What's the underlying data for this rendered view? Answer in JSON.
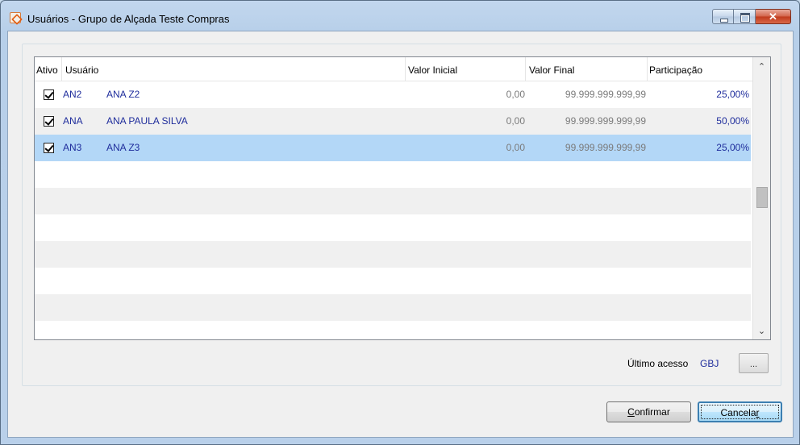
{
  "window": {
    "title": "Usuários - Grupo de Alçada Teste Compras",
    "close_glyph": "✕"
  },
  "grid": {
    "columns": [
      "Ativo",
      "Usuário",
      "Valor Inicial",
      "Valor Final",
      "Participação"
    ],
    "rows": [
      {
        "active": true,
        "code": "AN2",
        "name": "ANA Z2",
        "valor_inicial": "0,00",
        "valor_final": "99.999.999.999,99",
        "participacao": "25,00%"
      },
      {
        "active": true,
        "code": "ANA",
        "name": "ANA PAULA SILVA",
        "valor_inicial": "0,00",
        "valor_final": "99.999.999.999,99",
        "participacao": "50,00%"
      },
      {
        "active": true,
        "code": "AN3",
        "name": "ANA Z3",
        "valor_inicial": "0,00",
        "valor_final": "99.999.999.999,99",
        "participacao": "25,00%"
      }
    ],
    "selected_row": 2
  },
  "scroll": {
    "up": "⌃",
    "down": "⌄"
  },
  "footer": {
    "ultimo_acesso_label": "Último acesso",
    "ultimo_acesso_value": "GBJ",
    "browse_label": "..."
  },
  "buttons": {
    "confirmar_first": "C",
    "confirmar_rest": "onfirmar",
    "cancelar_prefix": "Cancela",
    "cancelar_underlined": "r"
  }
}
